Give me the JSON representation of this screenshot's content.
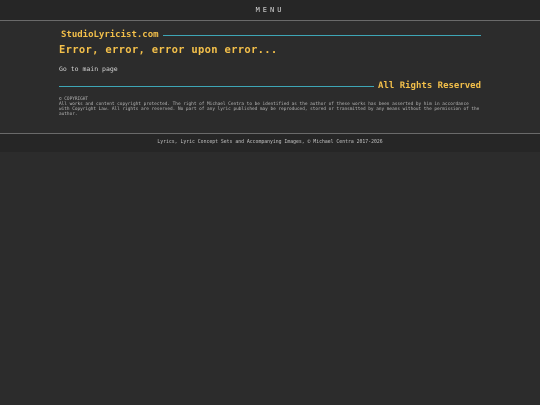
{
  "nav": {
    "menu_label": "MENU"
  },
  "site": {
    "title": "StudioLyricist.com"
  },
  "error": {
    "heading": "Error, error, error upon error...",
    "home_link": "Go to main page"
  },
  "rights": {
    "heading": "All Rights Reserved",
    "copyright_label": "© COPYRIGHT",
    "copyright_text": "All works and content copyright protected. The right of Michael Centra to be identified as the author of these works has been asserted by him in accordance with Copyright Law. All rights are reserved. No part of any lyric published may be reproduced, stored or transmitted by any means without the permission of the author."
  },
  "footer": {
    "text": "Lyrics, Lyric Concept Sets and Accompanying Images, © Michael Centra 2017-2026"
  },
  "colors": {
    "accent_gold": "#f4c04a",
    "rule_teal": "#3ea6b6",
    "background": "#2c2c2c"
  }
}
